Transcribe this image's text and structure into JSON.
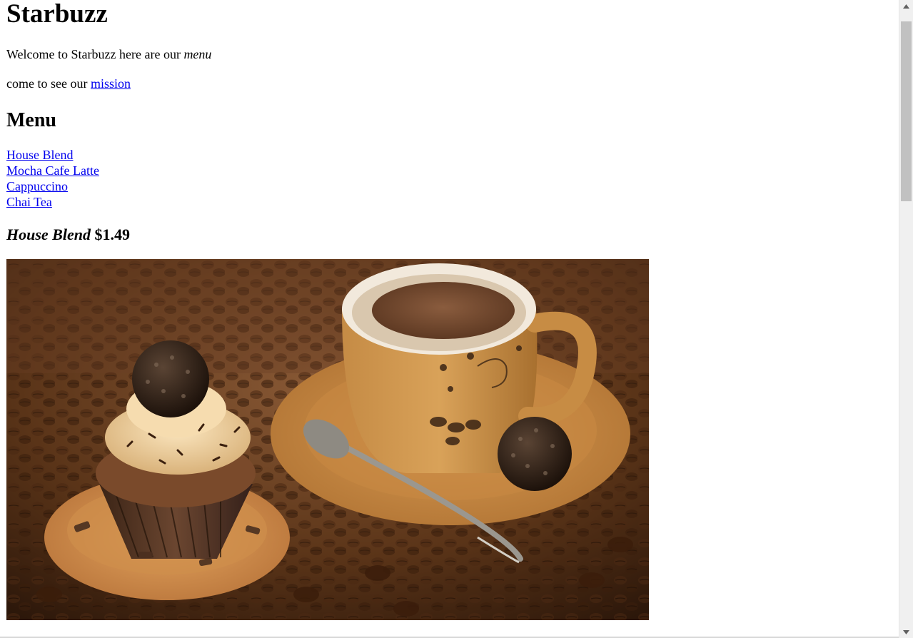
{
  "header": {
    "title": "Starbuzz"
  },
  "intro": {
    "welcome_text": "Welcome to Starbuzz here are our ",
    "welcome_emphasis": "menu",
    "come_text": "come to see our ",
    "mission_link": "mission"
  },
  "menu": {
    "heading": "Menu",
    "items": [
      {
        "label": "House Blend"
      },
      {
        "label": "Mocha Cafe Latte"
      },
      {
        "label": "Cappuccino"
      },
      {
        "label": "Chai Tea"
      }
    ]
  },
  "featured": {
    "name": "House Blend",
    "price": "$1.49"
  },
  "colors": {
    "link": "#0000EE",
    "scrollbar_track": "#f0f0f0",
    "scrollbar_thumb": "#c1c1c1"
  }
}
